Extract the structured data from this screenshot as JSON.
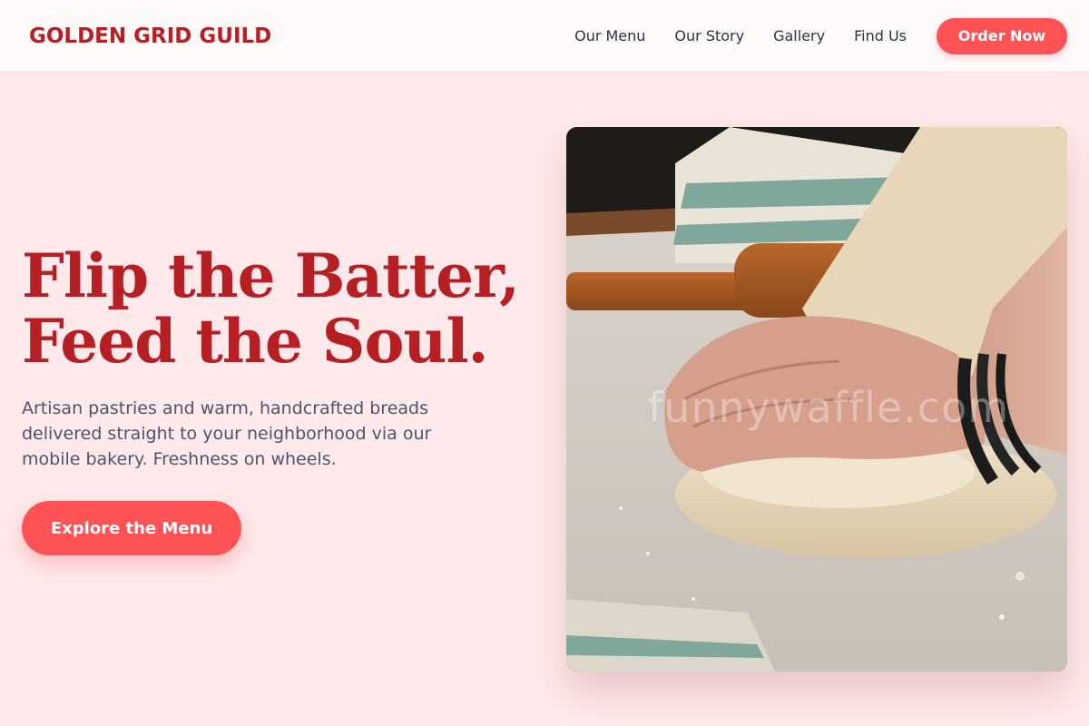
{
  "header": {
    "brand": "GOLDEN GRID GUILD",
    "nav": [
      {
        "label": "Our Menu"
      },
      {
        "label": "Our Story"
      },
      {
        "label": "Gallery"
      },
      {
        "label": "Find Us"
      }
    ],
    "cta_label": "Order Now"
  },
  "hero": {
    "title_line1": "Flip the Batter,",
    "title_line2": "Feed the Soul.",
    "description": "Artisan pastries and warm, handcrafted breads delivered straight to your neighborhood via our mobile bakery. Freshness on wheels.",
    "button_label": "Explore the Menu",
    "image_watermark": "funnywaffle.com"
  },
  "colors": {
    "brand": "#b61f24",
    "accent": "#ff5256",
    "background": "#ffe9ea",
    "navbar": "#fffafa",
    "text_muted": "#4b5568"
  }
}
